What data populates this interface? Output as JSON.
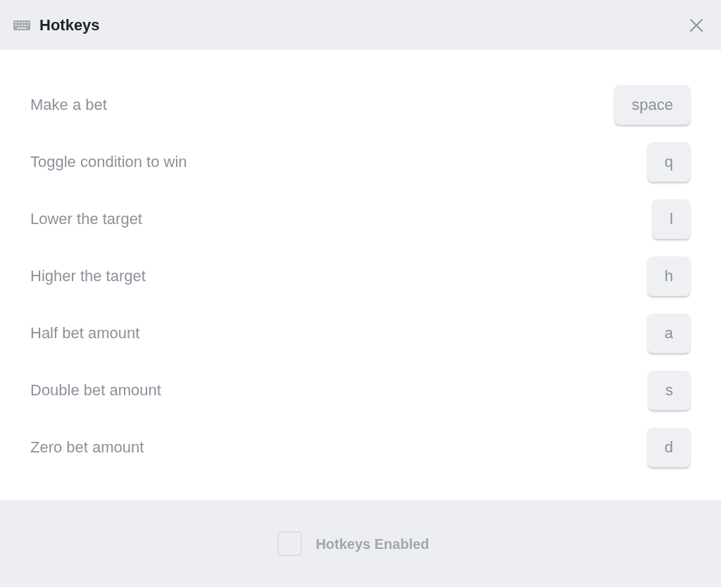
{
  "dialog": {
    "title": "Hotkeys"
  },
  "hotkeys": [
    {
      "action": "Make a bet",
      "key": "space"
    },
    {
      "action": "Toggle condition to win",
      "key": "q"
    },
    {
      "action": "Lower the target",
      "key": "l"
    },
    {
      "action": "Higher the target",
      "key": "h"
    },
    {
      "action": "Half bet amount",
      "key": "a"
    },
    {
      "action": "Double bet amount",
      "key": "s"
    },
    {
      "action": "Zero bet amount",
      "key": "d"
    }
  ],
  "footer": {
    "toggle": {
      "label": "Hotkeys Enabled",
      "checked": false
    }
  }
}
